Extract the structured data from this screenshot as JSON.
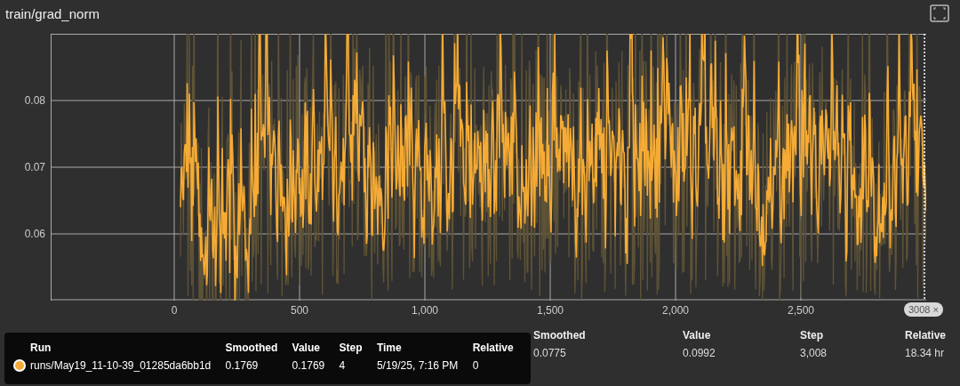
{
  "title": "train/grad_norm",
  "chart": {
    "y_ticks": [
      "0.08",
      "0.07",
      "0.06"
    ],
    "x_ticks": [
      "0",
      "500",
      "1,000",
      "1,500",
      "2,000",
      "2,500"
    ],
    "step_chip": "3008",
    "chip_close": "×"
  },
  "table": {
    "columns": [
      "Smoothed",
      "Value",
      "Step",
      "Relative"
    ],
    "row": [
      "0.0775",
      "0.0992",
      "3,008",
      "18.34 hr"
    ]
  },
  "tooltip": {
    "columns": [
      "Run",
      "Smoothed",
      "Value",
      "Step",
      "Time",
      "Relative"
    ],
    "rows": [
      {
        "color": "#f5ab35",
        "cells": [
          "runs/May19_11-10-39_01285da6bb1d",
          "0.1769",
          "0.1769",
          "4",
          "5/19/25, 7:16 PM",
          "0"
        ]
      }
    ]
  }
}
